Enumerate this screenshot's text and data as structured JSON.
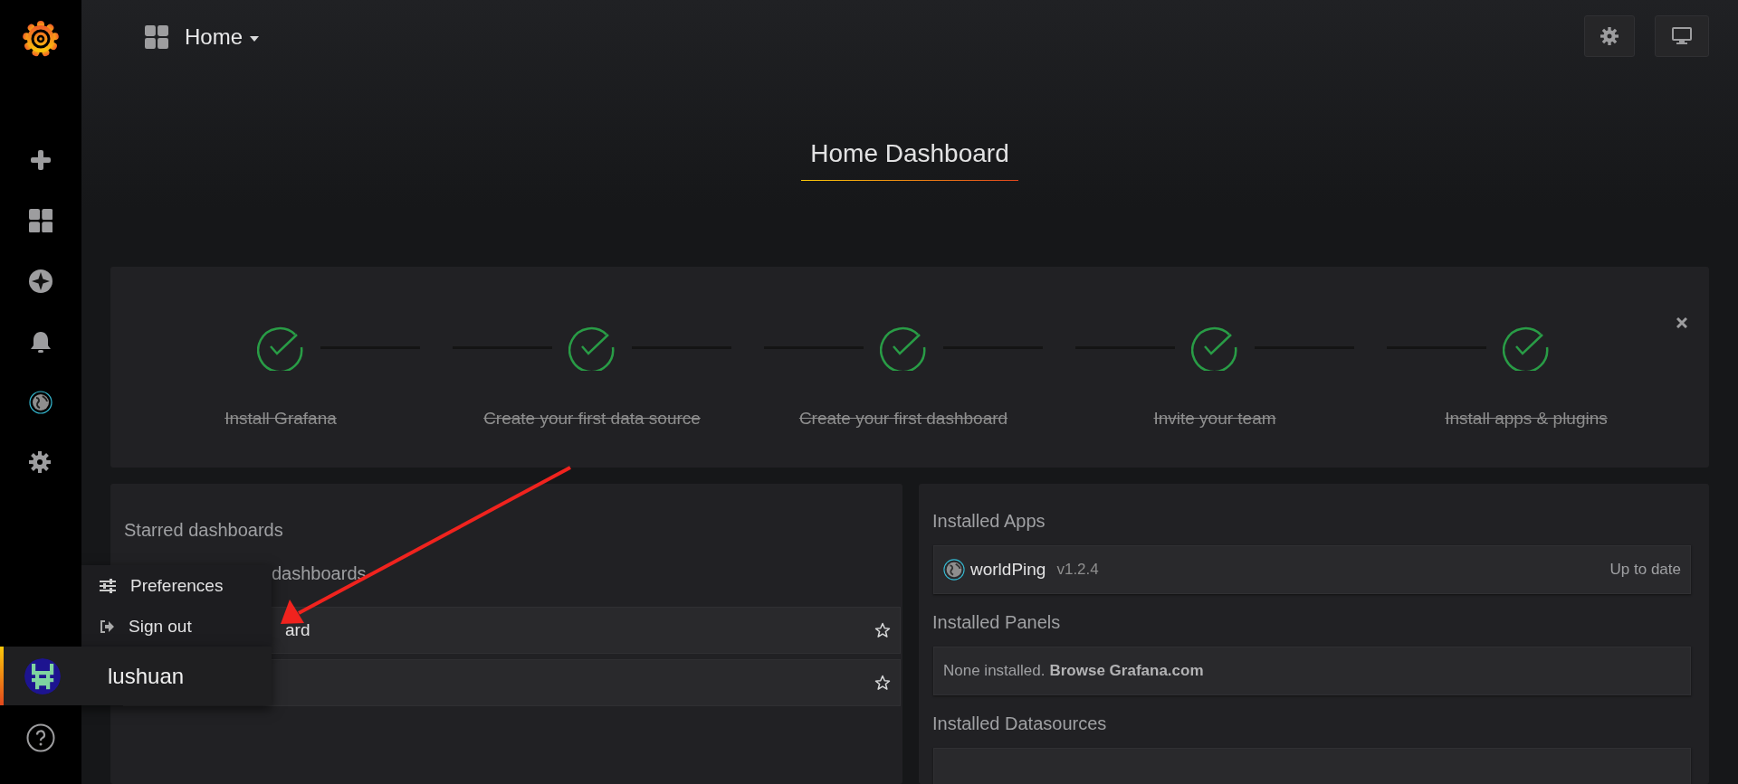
{
  "header": {
    "title": "Home"
  },
  "dashboard_title": "Home Dashboard",
  "steps": [
    {
      "label": "Install Grafana",
      "done": true
    },
    {
      "label": "Create your first data source",
      "done": true
    },
    {
      "label": "Create your first dashboard",
      "done": true
    },
    {
      "label": "Invite your team",
      "done": true
    },
    {
      "label": "Install apps & plugins",
      "done": true
    }
  ],
  "left_panel": {
    "starred_heading": "Starred dashboards",
    "recent_heading": "dashboards",
    "rows": [
      {
        "title": "ard",
        "starred": false
      },
      {
        "starred": false
      }
    ]
  },
  "right_panel": {
    "apps_heading": "Installed Apps",
    "apps": [
      {
        "name": "worldPing",
        "version": "v1.2.4",
        "status": "Up to date"
      }
    ],
    "panels_heading": "Installed Panels",
    "panels_empty": "None installed.",
    "panels_link": "Browse Grafana.com",
    "datasources_heading": "Installed Datasources"
  },
  "user_menu": {
    "items": [
      {
        "kind": "preferences",
        "label": "Preferences"
      },
      {
        "kind": "signout",
        "label": "Sign out"
      }
    ],
    "user": "lushuan"
  }
}
